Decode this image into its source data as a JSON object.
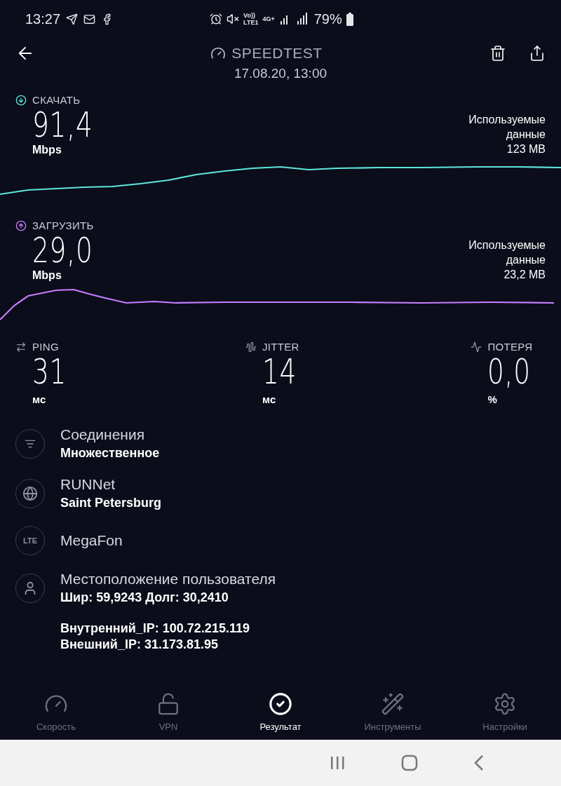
{
  "status_bar": {
    "time": "13:27",
    "volte_top": "Vo))",
    "volte_bottom": "LTE1",
    "network": "4G+",
    "battery": "79%"
  },
  "header": {
    "title": "SPEEDTEST",
    "date": "17.08.20, 13:00"
  },
  "tests": [
    {
      "kind": "download",
      "label": "СКАЧАТЬ",
      "value": "91,4",
      "unit": "Mbps",
      "data_label": "Используемые данные",
      "data_value": "123 MB",
      "color": "#5ee6dc"
    },
    {
      "kind": "upload",
      "label": "ЗАГРУЗИТЬ",
      "value": "29,0",
      "unit": "Mbps",
      "data_label": "Используемые данные",
      "data_value": "23,2 MB",
      "color": "#c77dff"
    }
  ],
  "metrics": [
    {
      "kind": "ping",
      "label": "PING",
      "value": "31",
      "unit": "мс"
    },
    {
      "kind": "jitter",
      "label": "JITTER",
      "value": "14",
      "unit": "мс"
    },
    {
      "kind": "loss",
      "label": "ПОТЕРЯ",
      "value": "0,0",
      "unit": "%"
    }
  ],
  "details": [
    {
      "kind": "connections",
      "title": "Соединения",
      "value": "Множественное"
    },
    {
      "kind": "server",
      "title": "RUNNet",
      "value": "Saint Petersburg"
    },
    {
      "kind": "provider",
      "badge": "LTE",
      "title": "MegaFon"
    },
    {
      "kind": "location",
      "title": "Местоположение пользователя",
      "value": "Шир: 59,9243 Долг: 30,2410"
    }
  ],
  "ip_lines": [
    "Внутренний_IP: 100.72.215.119",
    "Внешний_IP: 31.173.81.95"
  ],
  "nav": [
    {
      "kind": "speed",
      "label": "Скорость",
      "selected": false
    },
    {
      "kind": "vpn",
      "label": "VPN",
      "selected": false
    },
    {
      "kind": "result",
      "label": "Результат",
      "selected": true
    },
    {
      "kind": "tools",
      "label": "Инструменты",
      "selected": false
    },
    {
      "kind": "settings",
      "label": "Настройки",
      "selected": false
    }
  ]
}
